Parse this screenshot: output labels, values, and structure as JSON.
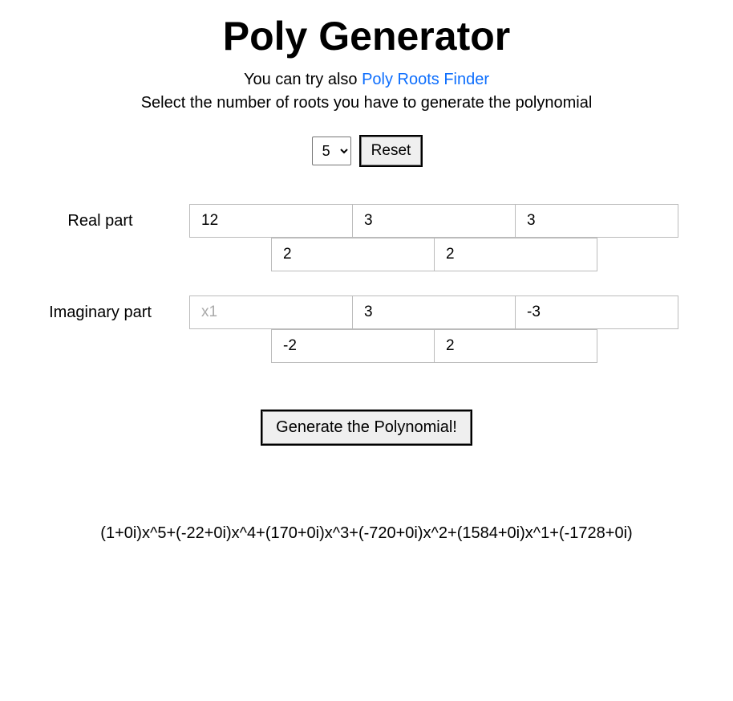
{
  "title": "Poly Generator",
  "subtitle_pre": "You can try also ",
  "subtitle_link": "Poly Roots Finder",
  "instruction": "Select the number of roots you have to generate the polynomial",
  "roots_count": "5",
  "reset_label": "Reset",
  "real": {
    "label": "Real part",
    "top": [
      "12",
      "3",
      "3"
    ],
    "bottom": [
      "2",
      "2"
    ]
  },
  "imag": {
    "label": "Imaginary part",
    "top_placeholder": "x1",
    "top": [
      "",
      "3",
      "-3"
    ],
    "bottom": [
      "-2",
      "2"
    ]
  },
  "generate_label": "Generate the Polynomial!",
  "result": "(1+0i)x^5+(-22+0i)x^4+(170+0i)x^3+(-720+0i)x^2+(1584+0i)x^1+(-1728+0i)"
}
